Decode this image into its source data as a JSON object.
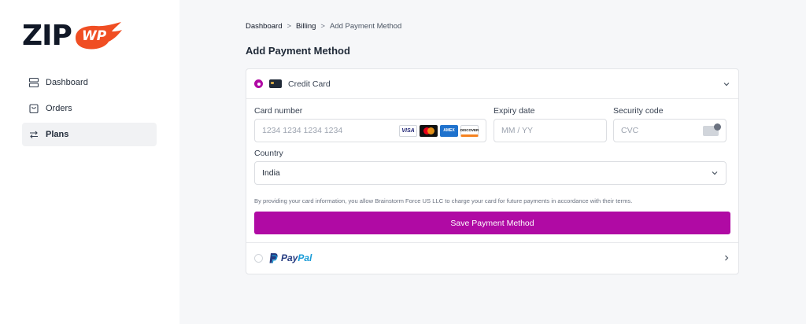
{
  "logo": {
    "primary": "ZIP",
    "secondary": "WP",
    "accent_color": "#f04e23"
  },
  "sidebar": {
    "items": [
      {
        "label": "Dashboard",
        "icon": "database-icon"
      },
      {
        "label": "Orders",
        "icon": "bag-icon"
      },
      {
        "label": "Plans",
        "icon": "repeat-icon",
        "active": true
      }
    ]
  },
  "breadcrumb": {
    "items": [
      "Dashboard",
      "Billing",
      "Add Payment Method"
    ],
    "separator": ">"
  },
  "page_title": "Add Payment Method",
  "payment_methods": {
    "credit_card": {
      "label": "Credit Card",
      "selected": true,
      "card_number": {
        "label": "Card number",
        "placeholder": "1234 1234 1234 1234"
      },
      "expiry": {
        "label": "Expiry date",
        "placeholder": "MM / YY"
      },
      "security": {
        "label": "Security code",
        "placeholder": "CVC"
      },
      "country": {
        "label": "Country",
        "value": "India"
      },
      "brands": [
        "VISA",
        "Mastercard",
        "AMEX",
        "DISCOVER"
      ],
      "disclaimer": "By providing your card information, you allow Brainstorm Force US LLC to charge your card for future payments in accordance with their terms.",
      "save_label": "Save Payment Method"
    },
    "paypal": {
      "label_pay": "Pay",
      "label_pal": "Pal",
      "selected": false
    }
  },
  "colors": {
    "accent": "#b00aa4",
    "paypal_dark": "#253b80",
    "paypal_light": "#179bd7"
  }
}
